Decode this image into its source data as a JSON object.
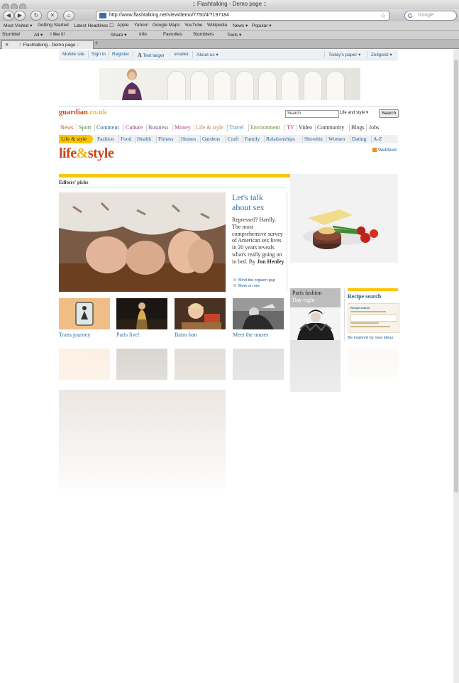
{
  "window": {
    "title": ":: Flashtalking - Demo page ::"
  },
  "toolbar": {
    "back": "◀",
    "forward": "▶",
    "reload": "↻",
    "stop": "✕",
    "home": "⌂",
    "url": "http://www.flashtalking.net/view/demo/7750/4/?197184",
    "search_placeholder": "Google"
  },
  "bookmarks": [
    "Most Visited ▾",
    "Getting Started",
    "Latest Headlines ☐",
    "Apple",
    "Yahoo!",
    "Google Maps",
    "YouTube",
    "Wikipedia",
    "News ▾",
    "Popular ▾"
  ],
  "stumble_toolbar": [
    "Stumble!",
    "All ▾",
    "I like it!",
    "Share ▾",
    "Info",
    "Favorites",
    "Stumblers",
    "Tools ▾"
  ],
  "tab": {
    "label": ":: Flashtalking - Demo page ::",
    "new_tab": "+"
  },
  "guardian": {
    "topnav": {
      "left": [
        "Mobile site",
        "Sign in",
        "Register",
        "Text larger",
        "smaller",
        "About us ▾"
      ],
      "right": [
        "Today's paper ▾",
        "Zeitgeist ▾"
      ]
    },
    "logo": {
      "main": "guardian",
      "suffix": ".co.uk"
    },
    "search": {
      "value": "Search",
      "section": "Life and style ▾",
      "button": "Search"
    },
    "main_nav": [
      {
        "label": "News",
        "color": "#c8461b"
      },
      {
        "label": "Sport",
        "color": "#4c8c2b"
      },
      {
        "label": "Comment",
        "color": "#1e5b94"
      },
      {
        "label": "Culture",
        "color": "#9b2c77"
      },
      {
        "label": "Business",
        "color": "#7a4f9a"
      },
      {
        "label": "Money",
        "color": "#a1457e"
      },
      {
        "label": "Life & style",
        "color": "#c87e3c"
      },
      {
        "label": "Travel",
        "color": "#2a86b7"
      },
      {
        "label": "Environment",
        "color": "#5a8a2b"
      },
      {
        "label": "TV",
        "color": "#b32a8e"
      },
      {
        "label": "Video",
        "color": "#333333"
      },
      {
        "label": "Community",
        "color": "#333333"
      },
      {
        "label": "Blogs",
        "color": "#333333"
      },
      {
        "label": "Jobs",
        "color": "#333333"
      }
    ],
    "sub_nav": [
      "Life & style",
      "Fashion",
      "Food",
      "Health",
      "Fitness",
      "Homes",
      "Gardens",
      "Craft",
      "Family",
      "Relationships",
      "Showbiz",
      "Women",
      "Dating",
      "A-Z"
    ],
    "section_title": {
      "a": "life",
      "amp": "&",
      "b": "style"
    },
    "webfeed": "Webfeed",
    "editors_picks": "Editors' picks",
    "lead": {
      "headline": "Let's talk about sex",
      "standfirst": "Repressed? Hardly. The most comprehensive survey of American sex lives in 20 years reveals what's really going on in bed. By",
      "byline": "Jon Henley",
      "links": [
        "Mind the orgasm gap",
        "More on sex"
      ]
    },
    "thumbs": [
      "Trans journey",
      "Paris live!",
      "Bairn ban",
      "Meet the muses"
    ],
    "fashion": {
      "title": "Paris fashion",
      "subtitle": "Day eight"
    },
    "recipe": {
      "title": "Recipe search",
      "link": "Be inspired by new ideas",
      "box_label": "Recipe search"
    }
  },
  "colors": {
    "accent_yellow": "#fcc500",
    "guardian_orange": "#c8461b",
    "link_blue": "#1e5b94"
  }
}
